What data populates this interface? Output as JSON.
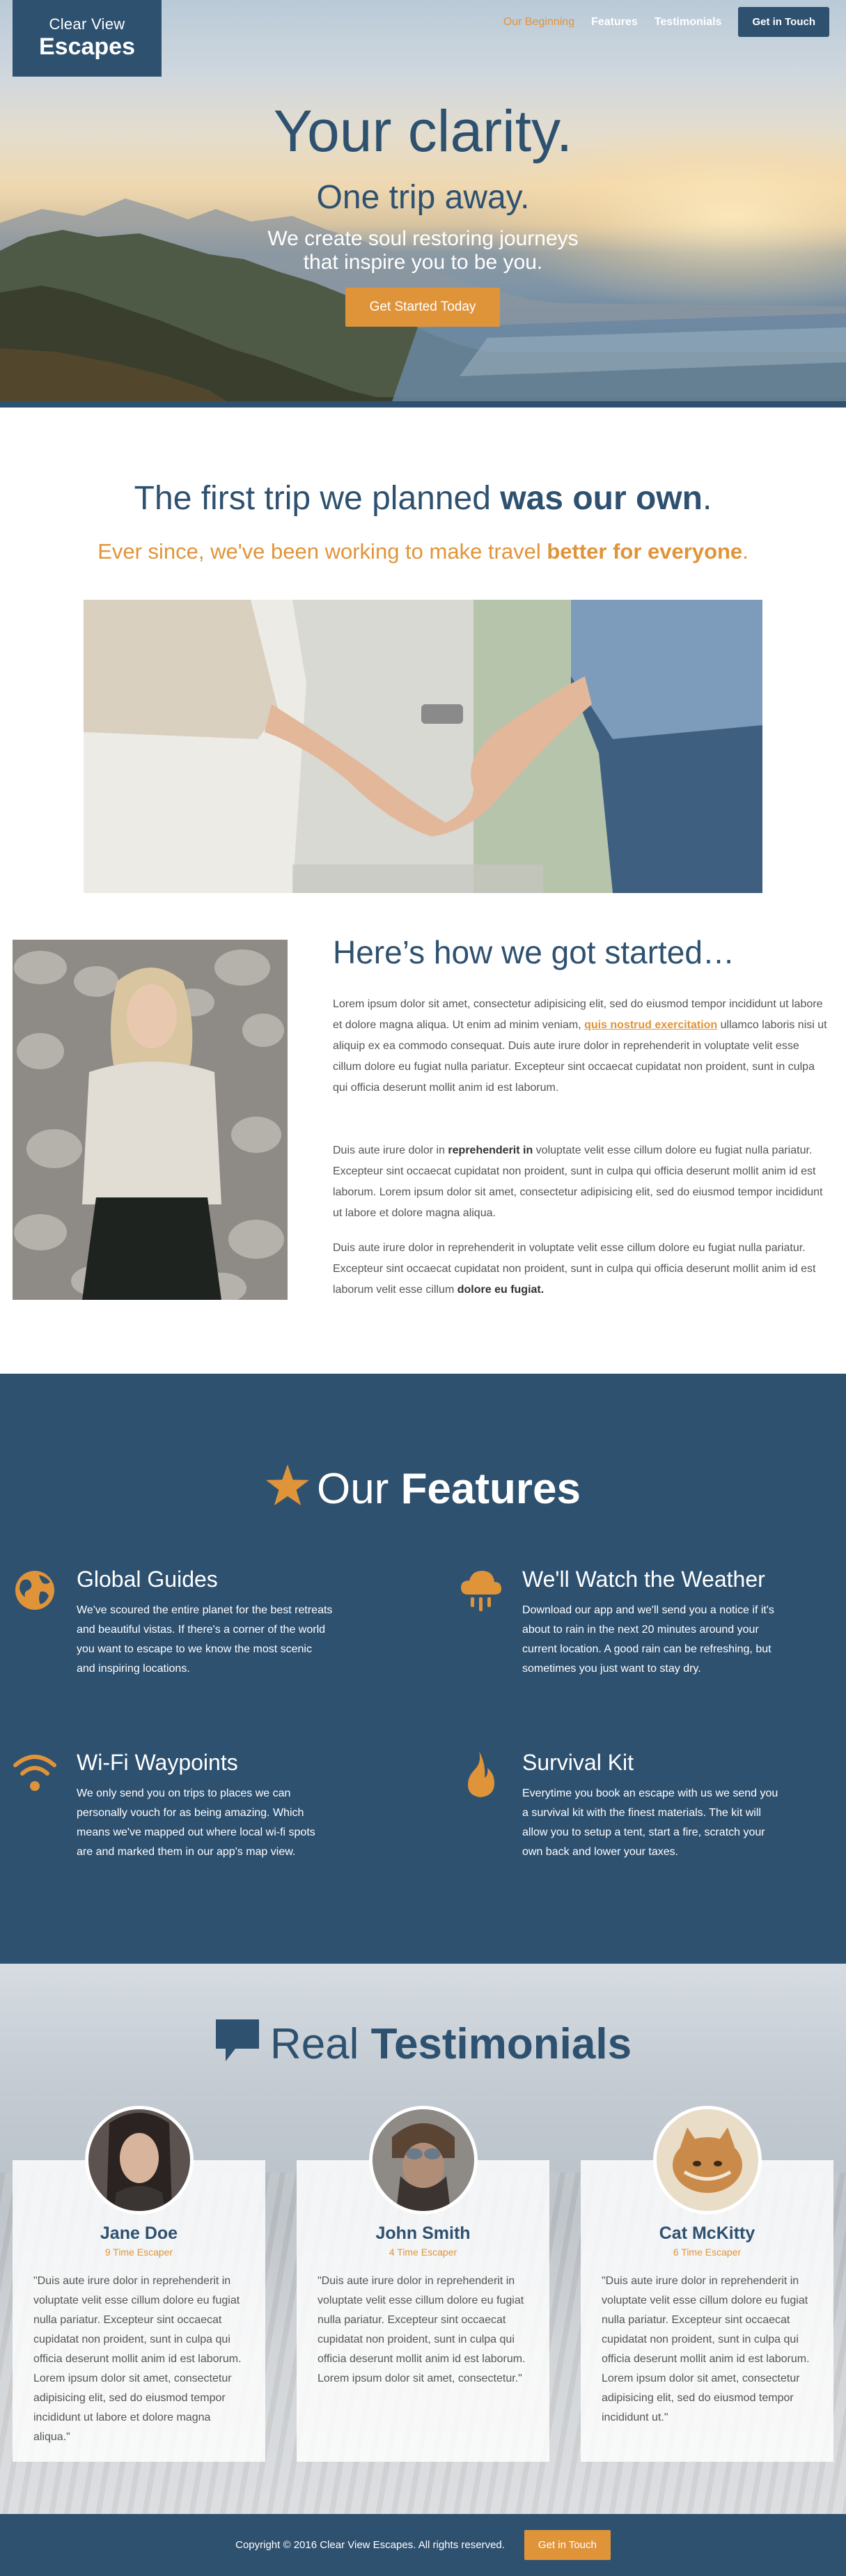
{
  "brand": {
    "line1": "Clear View",
    "line2": "Escapes"
  },
  "nav": {
    "items": [
      {
        "label": "Our Beginning",
        "active": true
      },
      {
        "label": "Features",
        "active": false
      },
      {
        "label": "Testimonials",
        "active": false
      }
    ],
    "cta_label": "Get in Touch"
  },
  "hero": {
    "title": "Your clarity.",
    "subtitle": "One trip away.",
    "description_line1": "We create soul restoring journeys",
    "description_line2": "that inspire you to be you.",
    "button_label": "Get Started Today"
  },
  "story": {
    "title_plain": "The first trip we planned ",
    "title_bold": "was our own",
    "title_end": ".",
    "subtitle_plain": "Ever since, we've been working to make travel ",
    "subtitle_bold": "better for everyone",
    "subtitle_end": ".",
    "heading": "Here’s how we got started…",
    "p1_a": "Lorem ipsum dolor sit amet, consectetur adipisicing elit, sed do eiusmod tempor incididunt ut labore et dolore magna aliqua. Ut enim ad minim veniam, ",
    "p1_link": "quis nostrud exercitation",
    "p1_b": " ullamco laboris nisi ut aliquip ex ea commodo consequat. Duis aute irure dolor in reprehenderit in voluptate velit esse cillum dolore eu fugiat nulla pariatur. Excepteur sint occaecat cupidatat non proident, sunt in culpa qui officia deserunt mollit anim id est laborum.",
    "p2_a": "Duis aute irure dolor in ",
    "p2_bold": "reprehenderit in",
    "p2_b": " voluptate velit esse cillum dolore eu fugiat nulla pariatur. Excepteur sint occaecat cupidatat non proident, sunt in culpa qui officia deserunt mollit anim id est laborum. Lorem ipsum dolor sit amet, consectetur adipisicing elit, sed do eiusmod tempor incididunt ut labore et dolore magna aliqua.",
    "p3_a": "Duis aute irure dolor in reprehenderit in voluptate velit esse cillum dolore eu fugiat nulla pariatur. Excepteur sint occaecat cupidatat non proident, sunt in culpa qui officia deserunt mollit anim id est laborum velit esse cillum ",
    "p3_bold": "dolore eu fugiat."
  },
  "features": {
    "title_plain": "Our ",
    "title_bold": "Features",
    "items": [
      {
        "icon": "globe-icon",
        "title": "Global Guides",
        "text": "We've scoured the entire planet for the best retreats and beautiful vistas. If there's a corner of the world you want to escape to we know the most scenic and inspiring locations."
      },
      {
        "icon": "cloud-rain-icon",
        "title": "We'll Watch the Weather",
        "text": "Download our app and we'll send you a notice if it's about to rain in the next 20 minutes around your current location. A good rain can be refreshing, but sometimes you just want to stay dry."
      },
      {
        "icon": "wifi-icon",
        "title": "Wi-Fi Waypoints",
        "text": "We only send you on trips to places we can personally vouch for as being amazing. Which means we've mapped out where local wi-fi spots are and marked them in our app's map view."
      },
      {
        "icon": "fire-icon",
        "title": "Survival Kit",
        "text": "Everytime you book an escape with us we send you a survival kit with the finest materials. The kit will allow you to setup a tent, start a fire, scratch your own back and lower your taxes."
      }
    ]
  },
  "testimonials": {
    "title_plain": "Real ",
    "title_bold": "Testimonials",
    "items": [
      {
        "name": "Jane Doe",
        "role": "9 Time Escaper",
        "quote": "\"Duis aute irure dolor in reprehenderit in voluptate velit esse cillum dolore eu fugiat nulla pariatur. Excepteur sint occaecat cupidatat non proident, sunt in culpa qui officia deserunt mollit anim id est laborum. Lorem ipsum dolor sit amet, consectetur adipisicing elit, sed do eiusmod tempor incididunt ut labore et dolore magna aliqua.\""
      },
      {
        "name": "John Smith",
        "role": "4 Time Escaper",
        "quote": "\"Duis aute irure dolor in reprehenderit in voluptate velit esse cillum dolore eu fugiat nulla pariatur. Excepteur sint occaecat cupidatat non proident, sunt in culpa qui officia deserunt mollit anim id est laborum. Lorem ipsum dolor sit amet, consectetur.\""
      },
      {
        "name": "Cat McKitty",
        "role": "6 Time Escaper",
        "quote": "\"Duis aute irure dolor in reprehenderit in voluptate velit esse cillum dolore eu fugiat nulla pariatur. Excepteur sint occaecat cupidatat non proident, sunt in culpa qui officia deserunt mollit anim id est laborum. Lorem ipsum dolor sit amet, consectetur adipisicing elit, sed do eiusmod tempor incididunt ut.\""
      }
    ]
  },
  "footer": {
    "copyright": "Copyright © 2016 Clear View Escapes. All rights reserved.",
    "button_label": "Get in Touch"
  },
  "colors": {
    "primary": "#2e5170",
    "accent": "#e0943a"
  }
}
